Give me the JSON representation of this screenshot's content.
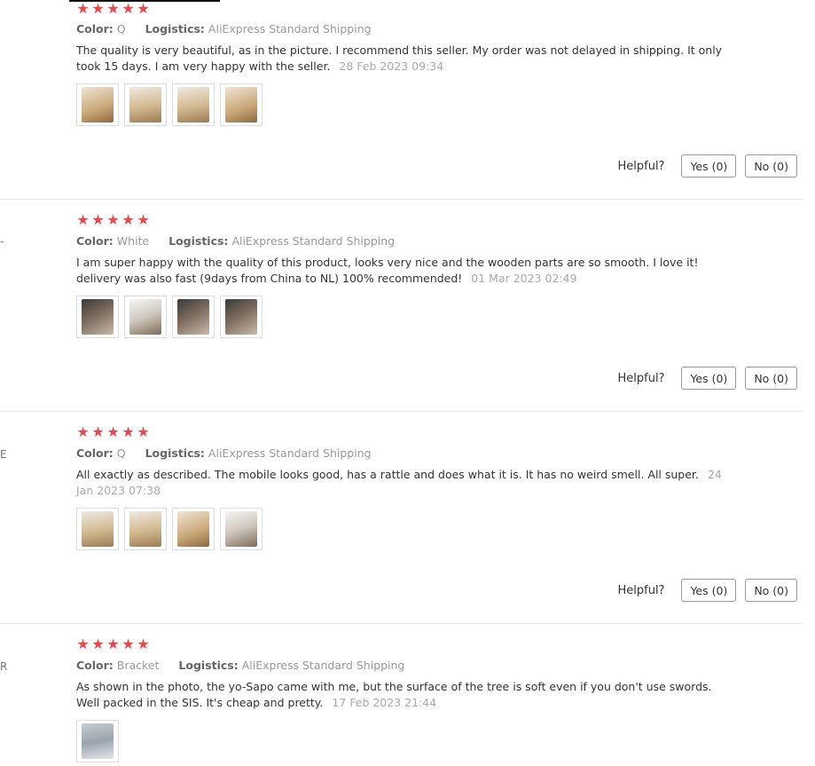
{
  "ui": {
    "helpful_label": "Helpful?",
    "star_glyph": "★",
    "color_label": "Color:",
    "logistics_label": "Logistics:"
  },
  "reviews": [
    {
      "color": "Q",
      "logistics": "AliExpress Standard Shipping",
      "text": "The quality is very beautiful, as in the picture. I recommend this seller. My order was not delayed in shipping. It only took 15 days. I am very happy with the seller.",
      "date": "28 Feb 2023 09:34",
      "yes_label": "Yes (0)",
      "no_label": "No (0)"
    },
    {
      "color": "White",
      "logistics": "AliExpress Standard Shipping",
      "text": "I am super happy with the quality of this product, looks very nice and the wooden parts are so smooth. I love it! delivery was also fast (9days from China to NL) 100% recommended!",
      "date": "01 Mar 2023 02:49",
      "yes_label": "Yes (0)",
      "no_label": "No (0)"
    },
    {
      "color": "Q",
      "logistics": "AliExpress Standard Shipping",
      "text": "All exactly as described. The mobile looks good, has a rattle and does what it is. It has no weird smell. All super.",
      "date": "24 Jan 2023 07:38",
      "yes_label": "Yes (0)",
      "no_label": "No (0)"
    },
    {
      "color": "Bracket",
      "logistics": "AliExpress Standard Shipping",
      "text": "As shown in the photo, the yo-Sapo came with me, but the surface of the tree is soft even if you don't use swords. Well packed in the SIS. It's cheap and pretty.",
      "date": "17 Feb 2023 21:44"
    }
  ],
  "edge_glyphs": [
    "-",
    "E",
    "R"
  ]
}
